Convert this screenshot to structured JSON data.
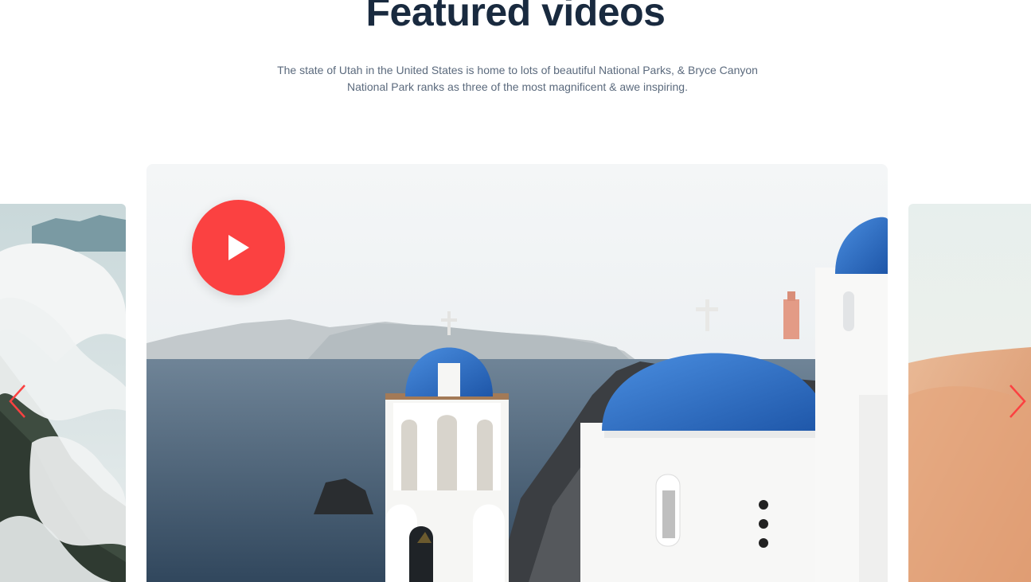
{
  "section": {
    "title": "Featured videos",
    "description": "The state of Utah in the United States is home to lots of beautiful National Parks, & Bryce Canyon National Park ranks as three of the most magnificent & awe inspiring."
  },
  "carousel": {
    "slides": [
      {
        "scene": "misty-mountains",
        "position": "previous"
      },
      {
        "scene": "santorini-blue-domes",
        "position": "current"
      },
      {
        "scene": "desert-dunes",
        "position": "next"
      }
    ],
    "play_icon": "play-icon",
    "prev_icon": "chevron-left-icon",
    "next_icon": "chevron-right-icon"
  },
  "colors": {
    "title": "#192a3f",
    "text": "#5b6a7d",
    "accent": "#fb4141",
    "dome_blue": "#2c6cc5"
  }
}
